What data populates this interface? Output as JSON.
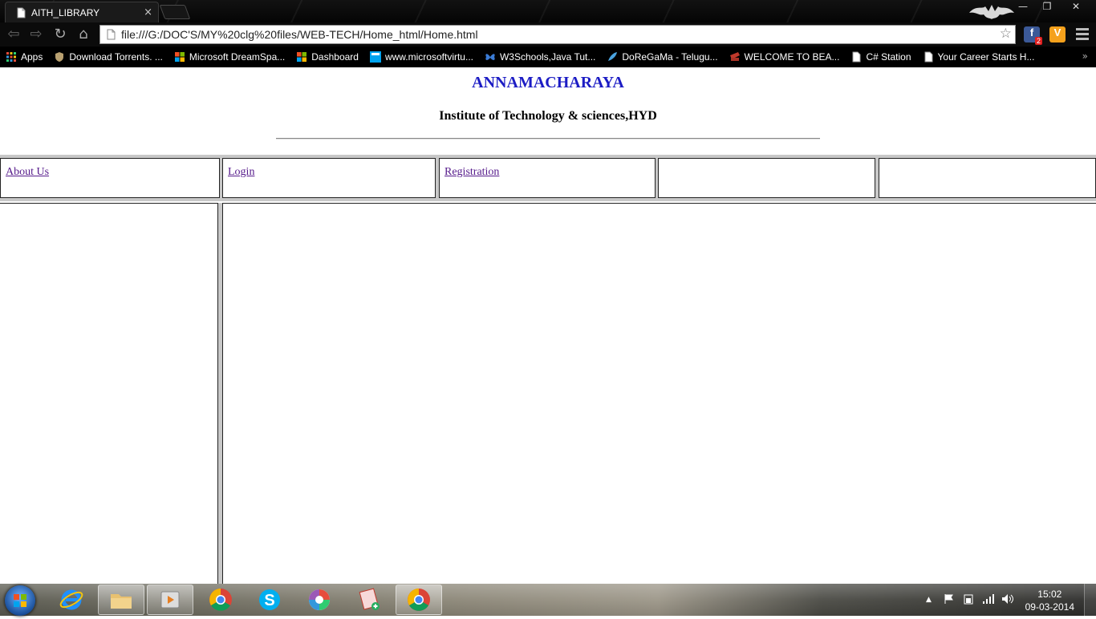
{
  "browser": {
    "tab_title": "AITH_LIBRARY",
    "tab_close": "×",
    "url": "file:///G:/DOC'S/MY%20clg%20files/WEB-TECH/Home_html/Home.html",
    "controls": {
      "minimize": "—",
      "restore": "❐",
      "close": "✕"
    },
    "nav": {
      "back": "⇦",
      "forward": "⇨",
      "reload": "↻",
      "home": "⌂"
    },
    "star_icon": "☆",
    "extensions": [
      {
        "label": "f",
        "badge": "2",
        "color": "#3b5998"
      },
      {
        "label": "V",
        "color": "#f5a11c"
      }
    ]
  },
  "bookmarks": {
    "items": [
      {
        "label": "Apps",
        "icon": "apps-grid-icon",
        "color": "#d9534f"
      },
      {
        "label": "Download Torrents. ...",
        "icon": "shield-icon",
        "color": "#b8a070"
      },
      {
        "label": "Microsoft DreamSpa...",
        "icon": "windows-logo-icon",
        "color": "#f25022"
      },
      {
        "label": "Dashboard",
        "icon": "windows-logo-icon",
        "color": "#f25022"
      },
      {
        "label": "www.microsoftvirtu...",
        "icon": "mva-icon",
        "color": "#00a4ef"
      },
      {
        "label": "W3Schools,Java Tut...",
        "icon": "butterfly-icon",
        "color": "#3a7bd5"
      },
      {
        "label": "DoReGaMa - Telugu...",
        "icon": "feather-icon",
        "color": "#4aa3df"
      },
      {
        "label": "WELCOME TO BEA...",
        "icon": "ticket-icon",
        "color": "#c0392b"
      },
      {
        "label": "C# Station",
        "icon": "page-icon",
        "color": "#ffffff"
      },
      {
        "label": "Your Career Starts H...",
        "icon": "page-icon",
        "color": "#ffffff"
      }
    ],
    "more": "»"
  },
  "page": {
    "title": "ANNAMACHARAYA",
    "subtitle": "Institute of Technology & sciences,HYD",
    "title_color": "#1c1cc4",
    "nav_links": [
      "About Us",
      "Login",
      "Registration",
      "",
      ""
    ],
    "link_color": "#551a8b"
  },
  "taskbar": {
    "apps": [
      {
        "name": "internet-explorer",
        "icon": "ie-icon",
        "active": false
      },
      {
        "name": "file-explorer",
        "icon": "folder-icon",
        "active": true
      },
      {
        "name": "media-player",
        "icon": "media-player-icon",
        "active": true
      },
      {
        "name": "chrome",
        "icon": "chrome-icon",
        "active": false
      },
      {
        "name": "skype",
        "icon": "skype-icon",
        "active": false
      },
      {
        "name": "picasa",
        "icon": "picasa-icon",
        "active": false
      },
      {
        "name": "notes",
        "icon": "notes-icon",
        "active": false
      },
      {
        "name": "chrome-active",
        "icon": "chrome-icon",
        "active": true
      }
    ],
    "tray": {
      "arrow": "▲",
      "time": "15:02",
      "date": "09-03-2014"
    }
  }
}
